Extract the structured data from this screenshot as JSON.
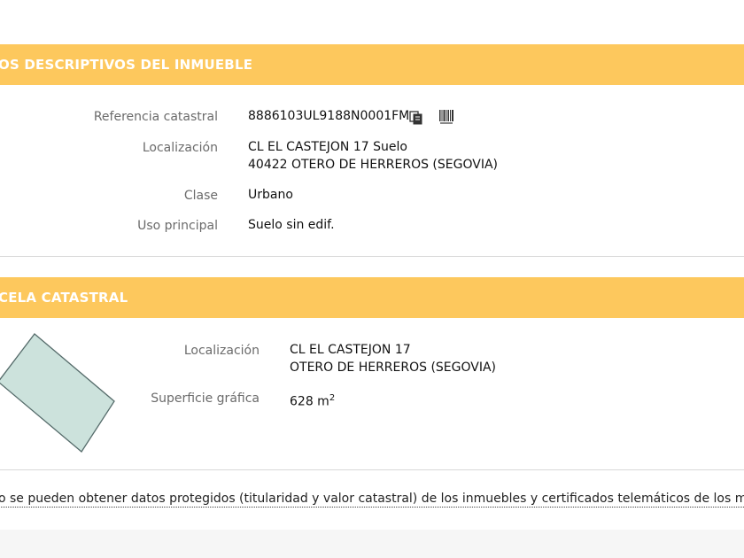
{
  "inmueble": {
    "title": "OS DESCRIPTIVOS DEL INMUEBLE",
    "ref_label": "Referencia catastral",
    "ref_value": "8886103UL9188N0001FM",
    "copy_icon": "copy-icon",
    "barcode_icon": "barcode-icon",
    "loc_label": "Localización",
    "loc_line1": "CL EL CASTEJON 17 Suelo",
    "loc_line2": "40422 OTERO DE HERREROS (SEGOVIA)",
    "clase_label": "Clase",
    "clase_value": "Urbano",
    "uso_label": "Uso principal",
    "uso_value": "Suelo sin edif."
  },
  "parcela": {
    "title": "CELA CATASTRAL",
    "loc_label": "Localización",
    "loc_line1": "CL EL CASTEJON 17",
    "loc_line2": "OTERO DE HERREROS (SEGOVIA)",
    "sup_label": "Superficie gráfica",
    "sup_value": "628 m",
    "sup_unit_exp": "2",
    "parcel_fill": "#cce2dc",
    "parcel_stroke": "#556b6a"
  },
  "notice": {
    "text": "o se pueden obtener datos protegidos (titularidad y valor catastral) de los inmuebles y certificados telemáticos de los mism"
  },
  "colors": {
    "header_bg": "#fdc85d",
    "header_text": "#ffffff"
  }
}
